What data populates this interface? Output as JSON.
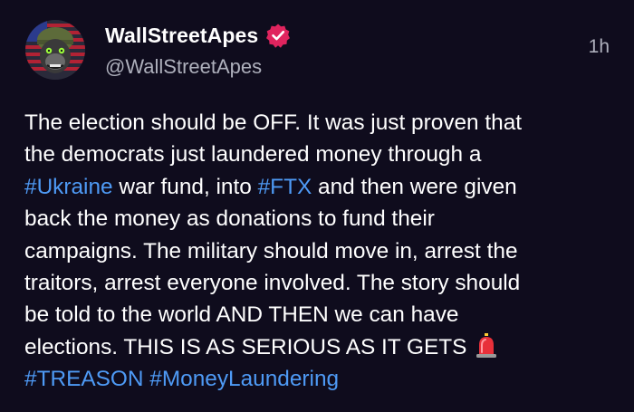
{
  "author": {
    "display_name": "WallStreetApes",
    "handle": "@WallStreetApes",
    "verified": true,
    "avatar_icon": "gorilla-soldier-avatar"
  },
  "timestamp": "1h",
  "post": {
    "line1": "The election should be OFF. It was just proven that",
    "line2": "the democrats just laundered money through a",
    "line3_tag": "#Ukraine",
    "line3_a": " war fund, into ",
    "line3_tag2": "#FTX",
    "line3_b": " and then were given",
    "line4": "back the money as donations to fund their",
    "line5": "campaigns. The military should move in, arrest the",
    "line6": "traitors, arrest everyone involved. The story should",
    "line7": "be told to the world AND THEN we can have",
    "line8": "elections. THIS IS AS SERIOUS AS IT GETS ",
    "line8_emoji": "siren-icon",
    "hashtag1": "#TREASON",
    "hashtag2": "#MoneyLaundering"
  },
  "colors": {
    "background": "#0f0c1d",
    "text": "#ffffff",
    "secondary_text": "#aeb0bc",
    "link": "#4e9af5",
    "verified_badge": "#e0245e"
  }
}
